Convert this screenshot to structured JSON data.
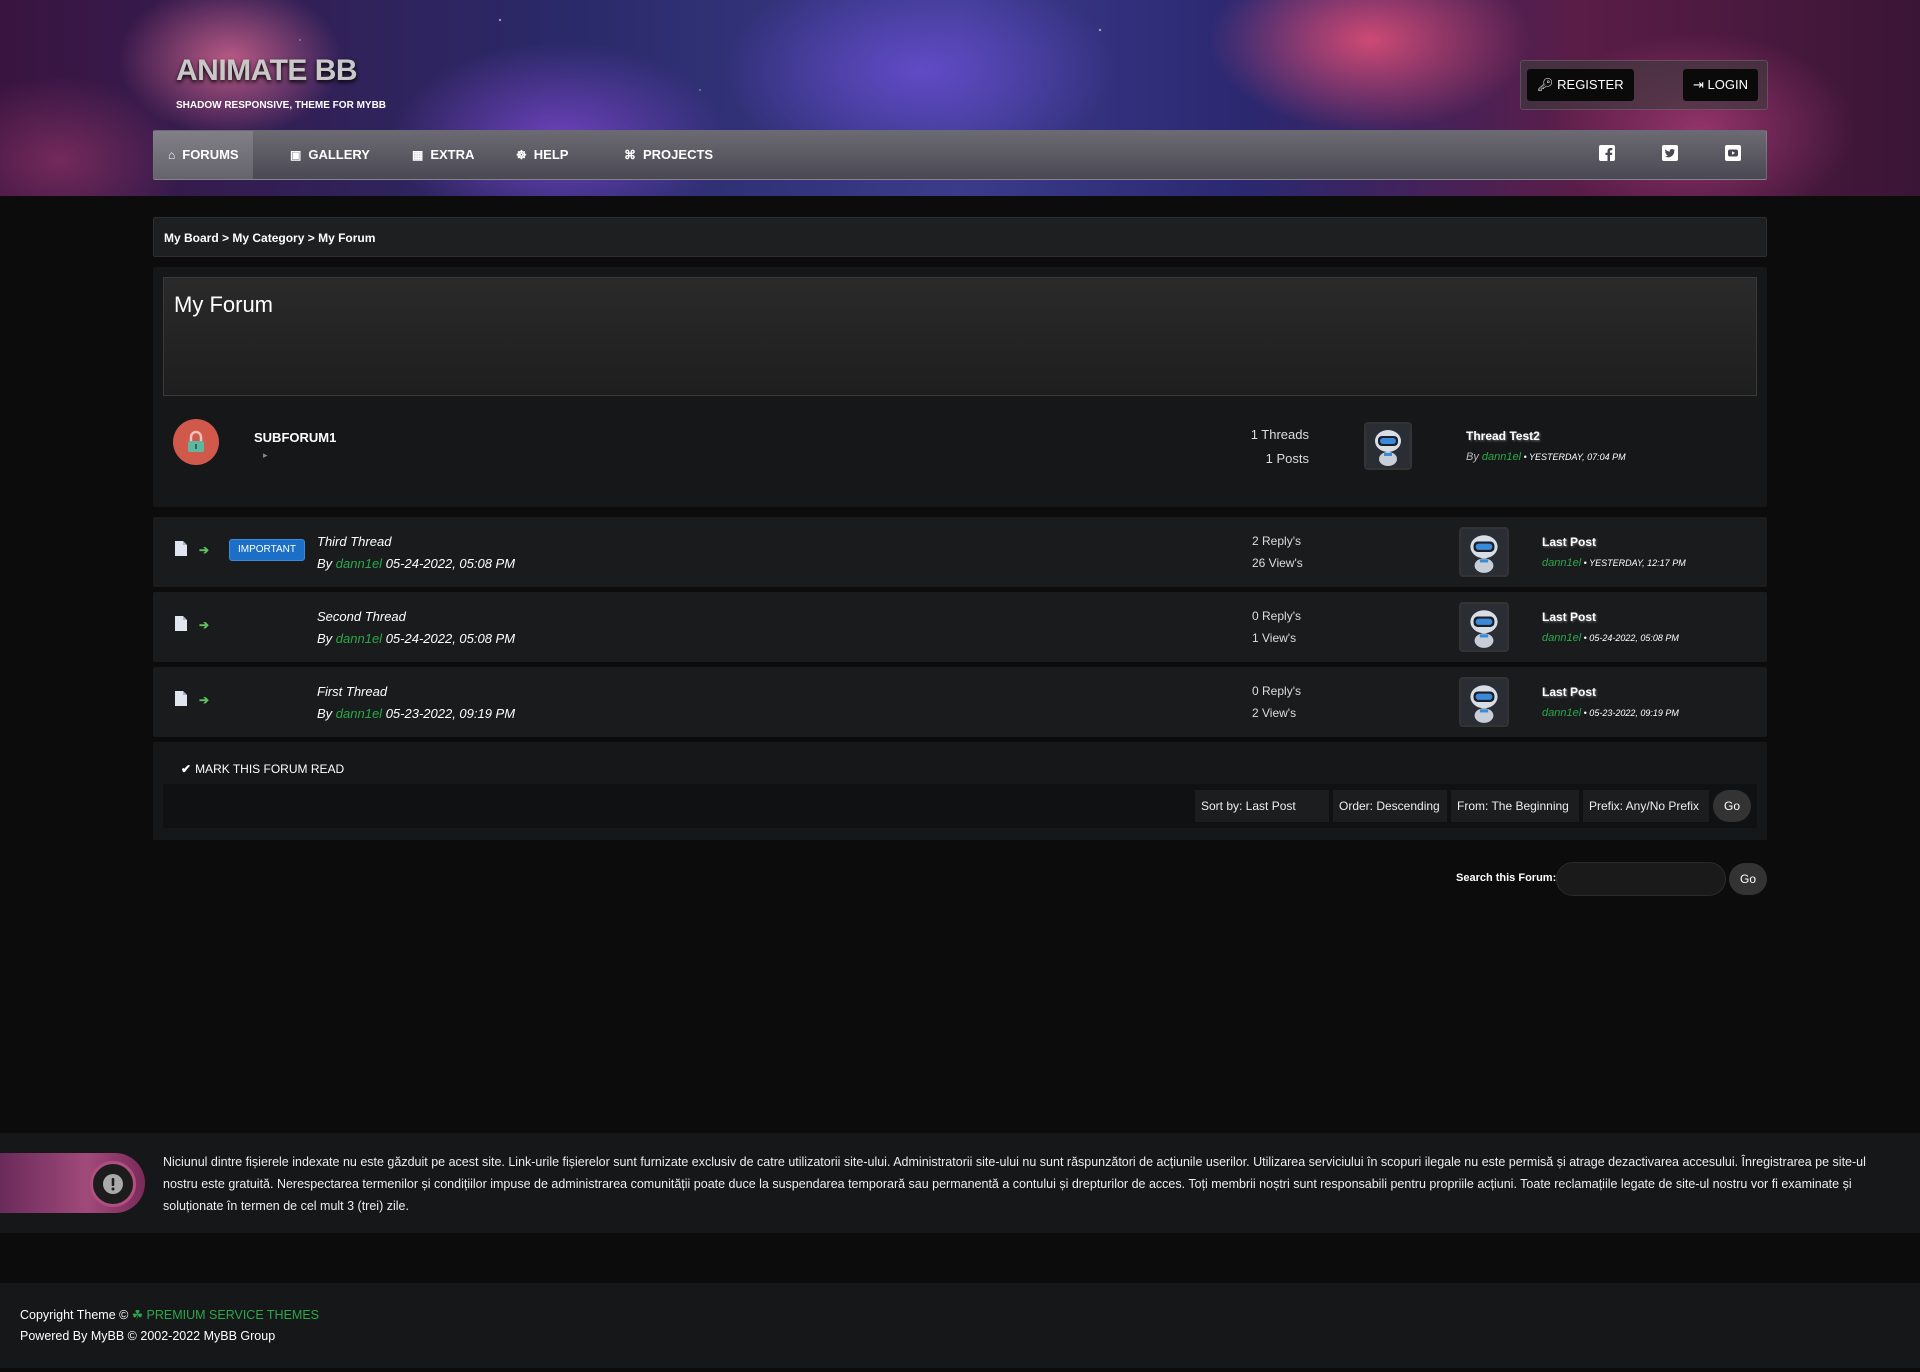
{
  "header": {
    "logo": "ANIMATE BB",
    "tagline": "SHADOW RESPONSIVE, THEME FOR MYBB",
    "register_label": "REGISTER",
    "login_label": "LOGIN"
  },
  "nav": {
    "items": [
      {
        "label": "FORUMS",
        "icon": "home-icon"
      },
      {
        "label": "GALLERY",
        "icon": "images-icon"
      },
      {
        "label": "EXTRA",
        "icon": "grid-icon"
      },
      {
        "label": "HELP",
        "icon": "lifebuoy-icon"
      },
      {
        "label": "PROJECTS",
        "icon": "sitemap-icon"
      }
    ],
    "social": [
      "facebook-icon",
      "twitter-icon",
      "youtube-icon"
    ]
  },
  "breadcrumb": {
    "items": [
      "My Board",
      "My Category",
      "My Forum"
    ],
    "sep": " > "
  },
  "forum": {
    "title": "My Forum",
    "subforum": {
      "name": "SUBFORUM1",
      "threads": "1 Threads",
      "posts": "1 Posts",
      "last_title": "Thread Test2",
      "by": "By",
      "user": "dann1el",
      "time": " • YESTERDAY, 07:04 PM"
    }
  },
  "threads": [
    {
      "badge": "IMPORTANT",
      "title": "Third Thread",
      "by": "By",
      "user": "dann1el",
      "date": " 05-24-2022, 05:08 PM",
      "replies": "2 Reply's",
      "views": "26 View's",
      "last_label": "Last Post",
      "last_user": "dann1el",
      "last_time": " • YESTERDAY, 12:17 PM"
    },
    {
      "badge": "",
      "title": "Second Thread",
      "by": "By",
      "user": "dann1el",
      "date": " 05-24-2022, 05:08 PM",
      "replies": "0 Reply's",
      "views": "1 View's",
      "last_label": "Last Post",
      "last_user": "dann1el",
      "last_time": " • 05-24-2022, 05:08 PM"
    },
    {
      "badge": "",
      "title": "First Thread",
      "by": "By",
      "user": "dann1el",
      "date": " 05-23-2022, 09:19 PM",
      "replies": "0 Reply's",
      "views": "2 View's",
      "last_label": "Last Post",
      "last_user": "dann1el",
      "last_time": " • 05-23-2022, 09:19 PM"
    }
  ],
  "controls": {
    "mark_read": "MARK THIS FORUM READ",
    "sort_by": "Sort by: Last Post",
    "order": "Order: Descending",
    "from": "From: The Beginning",
    "prefix": "Prefix: Any/No Prefix",
    "go": "Go",
    "search_label": "Search this Forum:",
    "search_go": "Go"
  },
  "disclaimer": {
    "text": "Niciunul dintre fișierele indexate nu este găzduit pe acest site. Link-urile fișierelor sunt furnizate exclusiv de catre utilizatorii site-ului. Administratorii site-ului nu sunt răspunzători de acțiunile userilor. Utilizarea serviciului în scopuri ilegale nu este permisă și atrage dezactivarea accesului. Înregistrarea pe site-ul nostru este gratuită. Nerespectarea termenilor și condițiilor impuse de administrarea comunității poate duce la suspendarea temporară sau permanentă a contului și drepturilor de acces. Toți membrii noștri sunt responsabili pentru propriile acțiuni. Toate reclamațiile legate de site-ul nostru vor fi examinate și soluționate în termen de cel mult 3 (trei) zile.",
    "icon": "exclamation-icon"
  },
  "footer": {
    "copyright_prefix": "Copyright Theme © ",
    "copyright_link": "PREMIUM SERVICE THEMES",
    "powered": "Powered By MyBB © 2002-2022 MyBB Group"
  },
  "colors": {
    "accent_green": "#2aa84a",
    "badge_blue": "#1b6fc6",
    "lock_red": "#d0594b"
  }
}
